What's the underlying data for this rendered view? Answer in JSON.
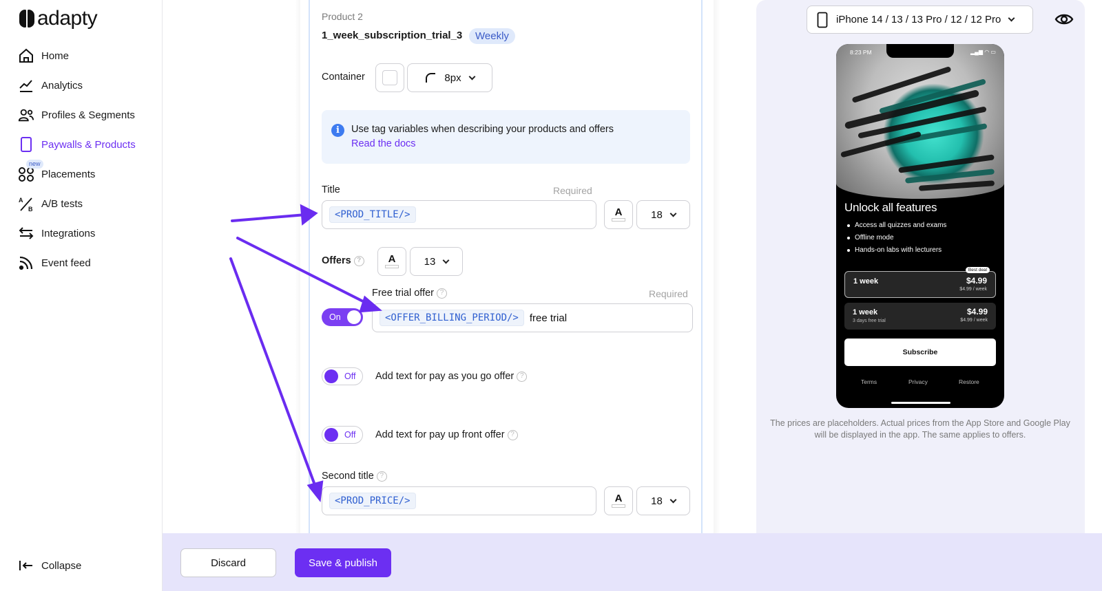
{
  "app": {
    "logo_text": "adapty"
  },
  "sidebar": {
    "items": [
      {
        "label": "Home",
        "icon": "home-icon"
      },
      {
        "label": "Analytics",
        "icon": "analytics-icon"
      },
      {
        "label": "Profiles & Segments",
        "icon": "users-icon"
      },
      {
        "label": "Paywalls & Products",
        "icon": "phone-icon",
        "active": true
      },
      {
        "label": "Placements",
        "icon": "placements-icon",
        "badge": "new"
      },
      {
        "label": "A/B tests",
        "icon": "ab-test-icon"
      },
      {
        "label": "Integrations",
        "icon": "arrows-swap-icon"
      },
      {
        "label": "Event feed",
        "icon": "feed-icon"
      }
    ],
    "collapse_label": "Collapse"
  },
  "form": {
    "product_heading": "Product 2",
    "product_id": "1_week_subscription_trial_3",
    "product_period_badge": "Weekly",
    "container_label": "Container",
    "container_radius": "8px",
    "info_text": "Use tag variables when describing your products and offers",
    "info_link": "Read the docs",
    "title": {
      "label": "Title",
      "required": "Required",
      "tag": "<PROD_TITLE/>",
      "text_icon": "A",
      "font_size": "18"
    },
    "offers": {
      "label": "Offers",
      "text_icon": "A",
      "font_size": "13"
    },
    "free_trial": {
      "label": "Free trial offer",
      "required": "Required",
      "toggle": "On",
      "tag": "<OFFER_BILLING_PERIOD/>",
      "suffix": "free trial"
    },
    "pay_as_you_go": {
      "toggle": "Off",
      "label": "Add text for pay as you go offer"
    },
    "pay_up_front": {
      "toggle": "Off",
      "label": "Add text for pay up front offer"
    },
    "second_title": {
      "label": "Second title",
      "tag": "<PROD_PRICE/>",
      "text_icon": "A",
      "font_size": "18"
    }
  },
  "preview": {
    "device": "iPhone 14 / 13 / 13 Pro / 12 / 12 Pro",
    "phone": {
      "time": "8:23 PM",
      "title": "Unlock all features",
      "bullets": [
        "Access all quizzes and exams",
        "Offline mode",
        "Hands-on labs with lecturers"
      ],
      "products": [
        {
          "name": "1 week",
          "sub": "",
          "price": "$4.99",
          "per": "$4.99 / week",
          "badge": "Best deal"
        },
        {
          "name": "1 week",
          "sub": "3 days free trial",
          "price": "$4.99",
          "per": "$4.99 / week"
        }
      ],
      "subscribe": "Subscribe",
      "footer": [
        "Terms",
        "Privacy",
        "Restore"
      ]
    },
    "caption": "The prices are placeholders. Actual prices from the App Store and Google Play will be displayed in the app. The same applies to offers."
  },
  "actions": {
    "discard": "Discard",
    "save": "Save & publish"
  },
  "colors": {
    "accent": "#6c2ff2",
    "toggle_on": "#7b3ff2",
    "badge_bg": "#dfe9fb",
    "bottom_bar": "#e6e4fb",
    "preview_bg": "#f0f0fa"
  }
}
